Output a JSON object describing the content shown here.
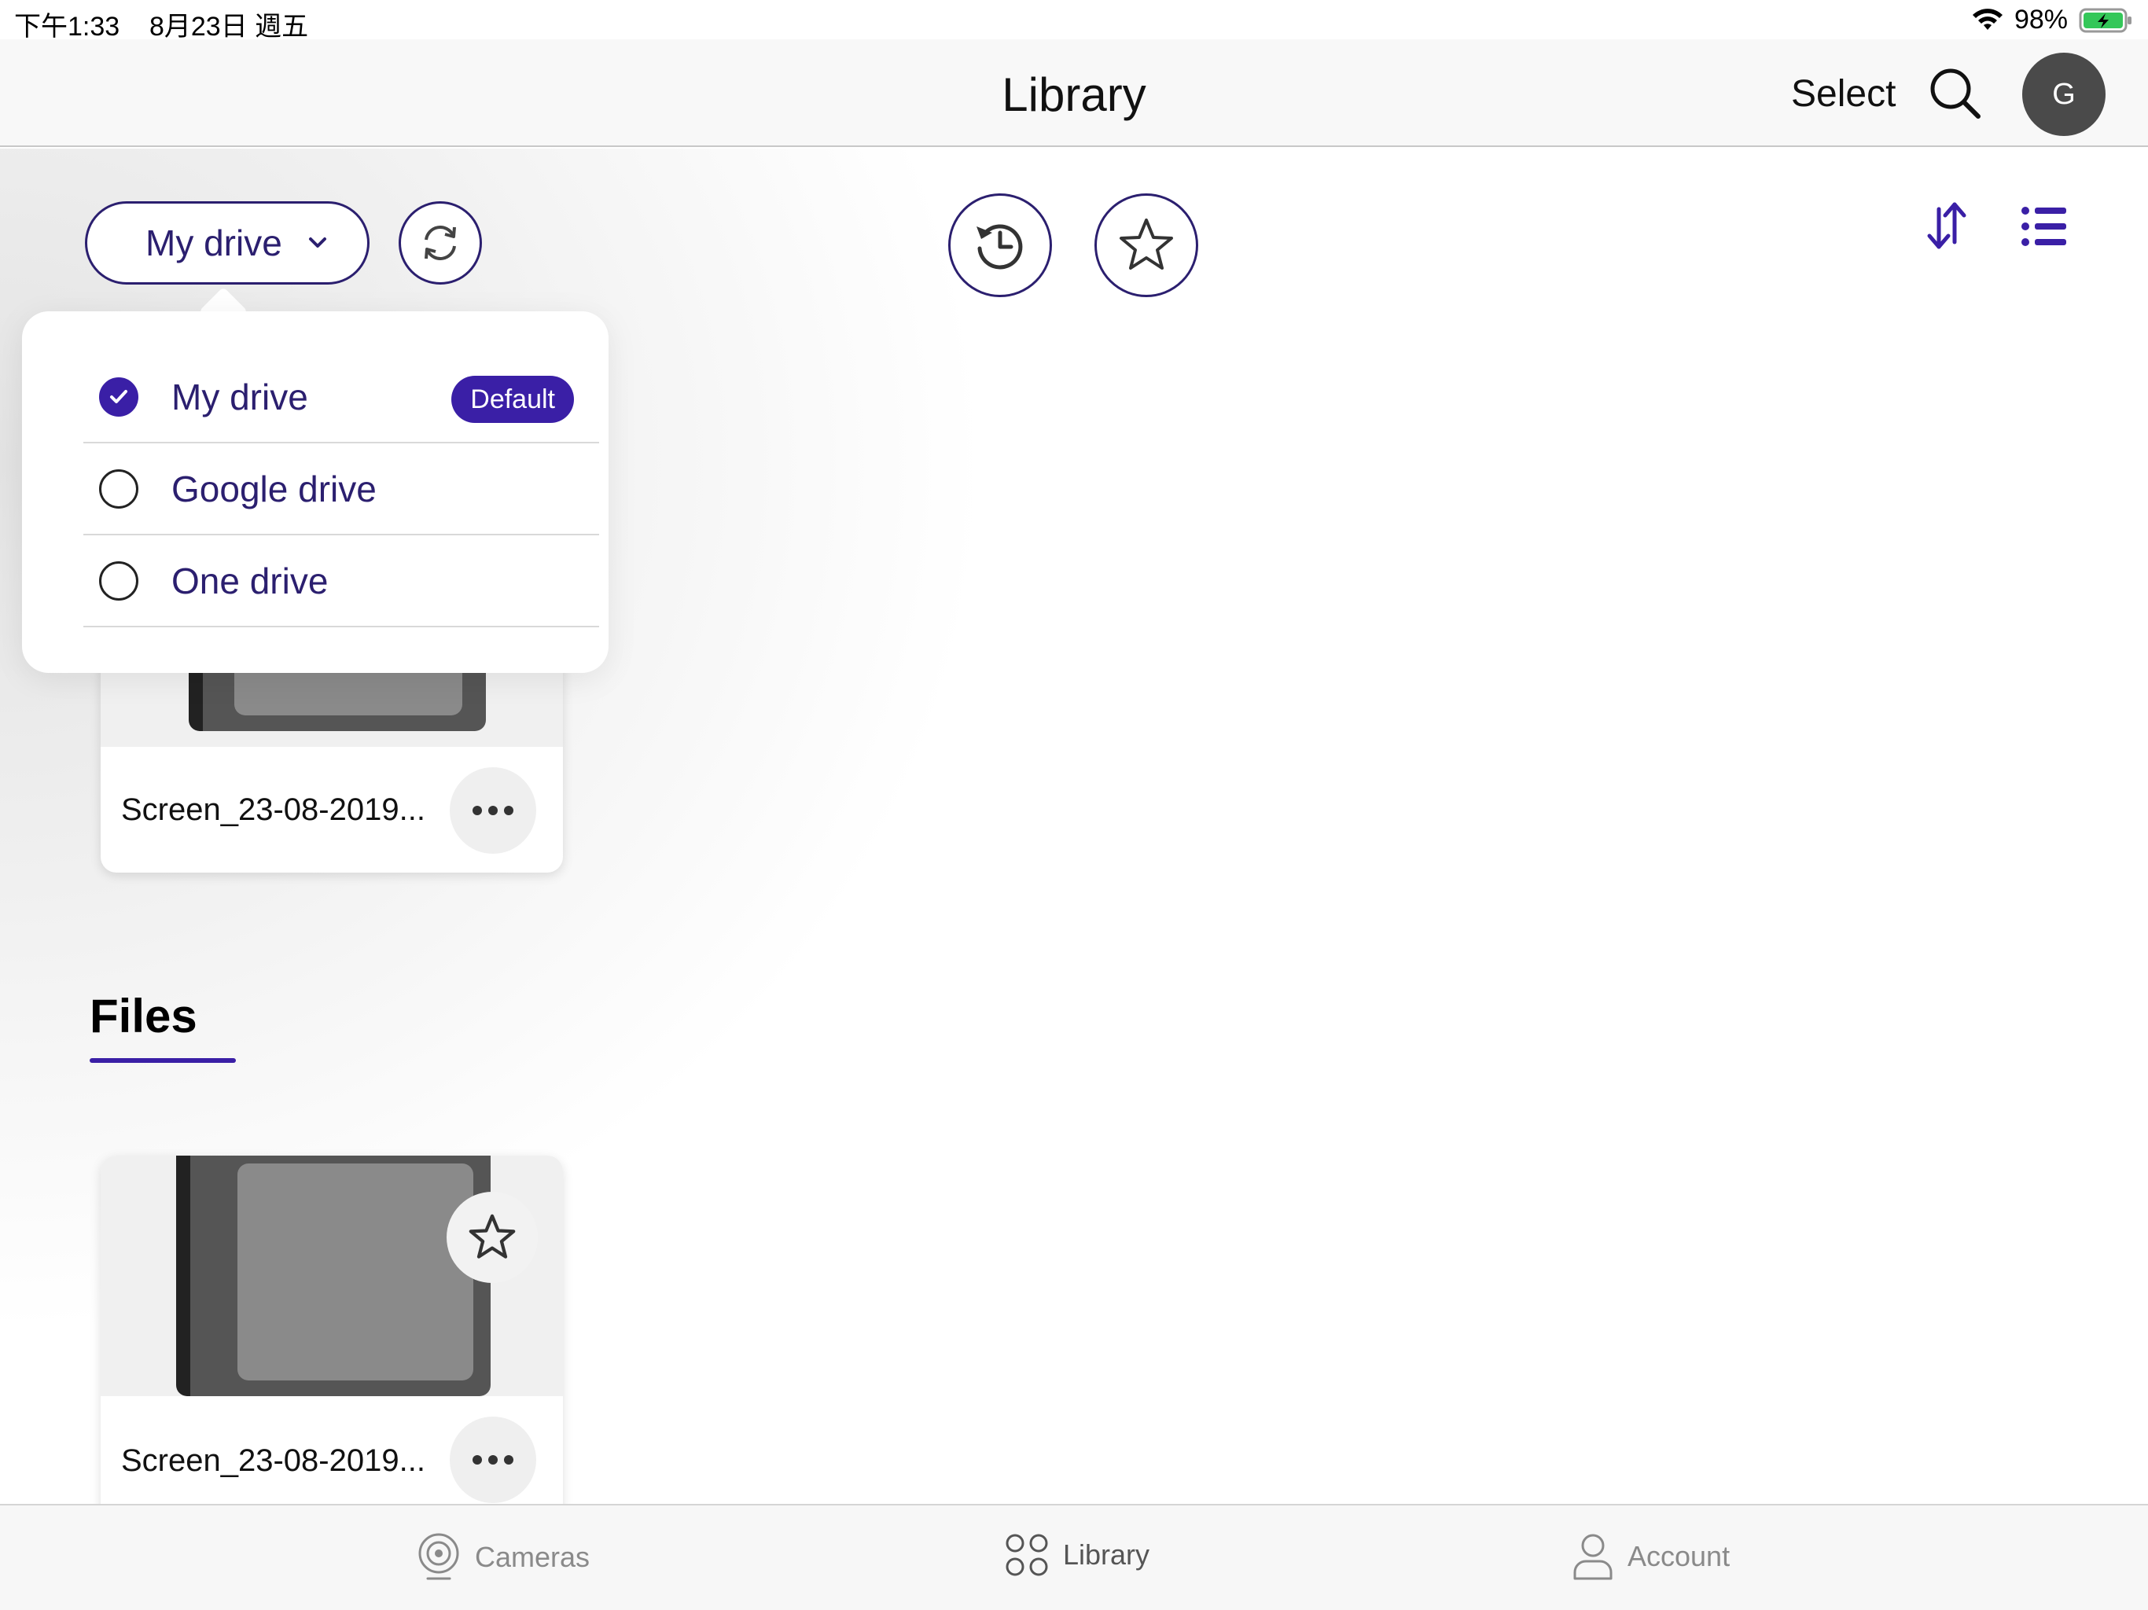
{
  "status_bar": {
    "time": "下午1:33",
    "date": "8月23日 週五",
    "battery": "98%"
  },
  "header": {
    "title": "Library",
    "select_label": "Select",
    "avatar_initial": "G"
  },
  "toolbar": {
    "drive_selected": "My drive"
  },
  "drive_menu": {
    "options": [
      {
        "label": "My drive",
        "checked": true,
        "badge": "Default"
      },
      {
        "label": "Google drive",
        "checked": false
      },
      {
        "label": "One drive",
        "checked": false
      }
    ]
  },
  "recent_card": {
    "name": "Screen_23-08-2019..."
  },
  "files": {
    "heading": "Files",
    "items": [
      {
        "name": "Screen_23-08-2019..."
      }
    ]
  },
  "tabbar": {
    "tabs": [
      {
        "label": "Cameras"
      },
      {
        "label": "Library"
      },
      {
        "label": "Account"
      }
    ]
  },
  "colors": {
    "accent": "#3a1fa6",
    "outline": "#2b1f6f"
  },
  "icons": {
    "wifi": "wifi-icon",
    "battery": "battery-icon",
    "search": "search-icon",
    "chevron": "chevron-down-icon",
    "sync": "sync-icon",
    "recent": "history-icon",
    "favorite": "star-icon",
    "sort": "sort-icon",
    "list": "list-view-icon",
    "more": "more-icon",
    "camera": "camera-icon",
    "library": "grid-icon",
    "account": "person-icon"
  }
}
